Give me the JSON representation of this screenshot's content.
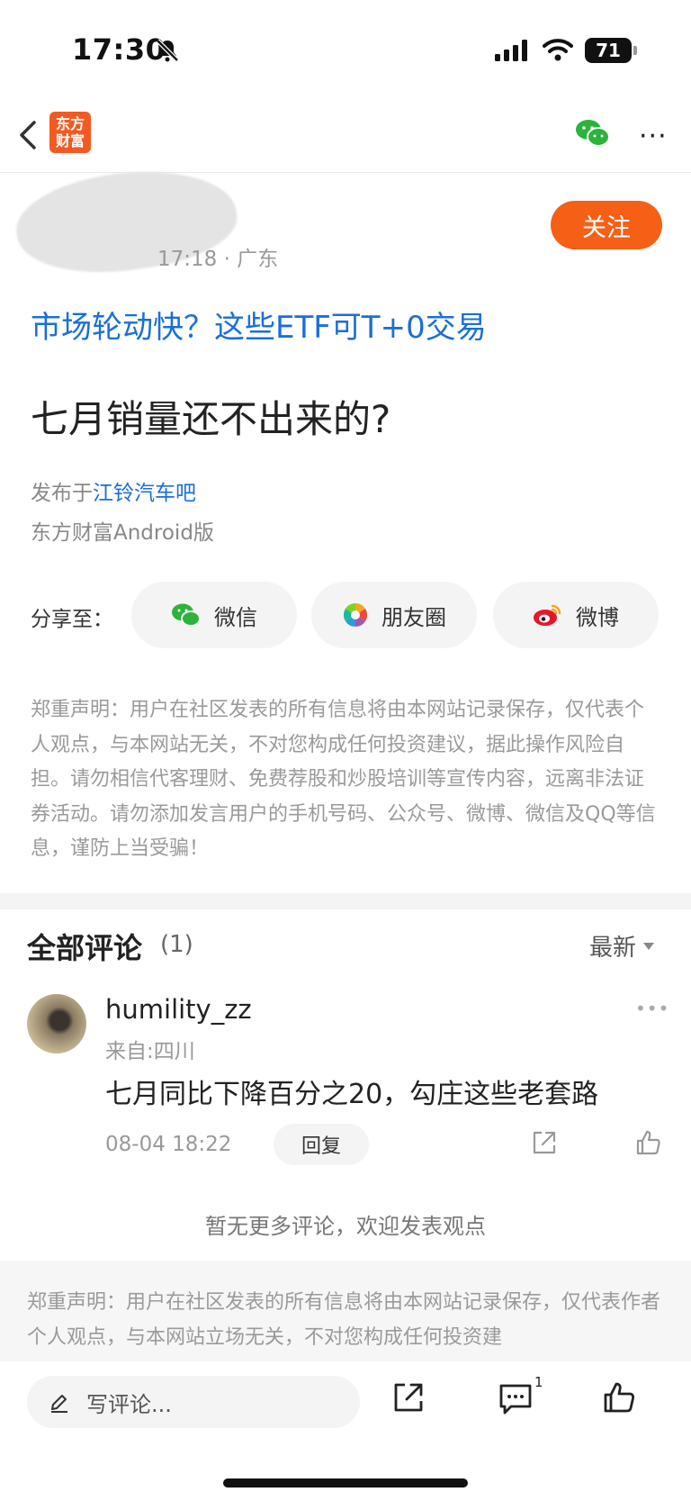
{
  "status": {
    "time": "17:30",
    "battery": "71"
  },
  "nav": {
    "logo_text": "东方财富"
  },
  "post": {
    "meta": "17:18 · 广东",
    "follow_label": "关注",
    "ad_link": "市场轮动快？这些ETF可T+0交易",
    "title": "七月销量还不出来的?",
    "published_prefix": "发布于",
    "bar_name": "江铃汽车吧",
    "platform": "东方财富Android版",
    "share_label": "分享至：",
    "share_options": [
      {
        "label": "微信",
        "icon": "wechat-icon"
      },
      {
        "label": "朋友圈",
        "icon": "moments-icon"
      },
      {
        "label": "微博",
        "icon": "weibo-icon"
      }
    ],
    "disclaimer": "郑重声明：用户在社区发表的所有信息将由本网站记录保存，仅代表个人观点，与本网站无关，不对您构成任何投资建议，据此操作风险自担。请勿相信代客理财、免费荐股和炒股培训等宣传内容，远离非法证券活动。请勿添加发言用户的手机号码、公众号、微博、微信及QQ等信息，谨防上当受骗！"
  },
  "comments": {
    "title": "全部评论",
    "count": "(1)",
    "sort_label": "最新",
    "items": [
      {
        "user": "humility_zz",
        "from": "来自:四川",
        "text": "七月同比下降百分之20，勾庄这些老套路",
        "time": "08-04 18:22",
        "reply_label": "回复"
      }
    ],
    "no_more": "暂无更多评论，欢迎发表观点"
  },
  "footer_disclaimer": "郑重声明：用户在社区发表的所有信息将由本网站记录保存，仅代表作者个人观点，与本网站立场无关，不对您构成任何投资建",
  "bottom_bar": {
    "input_placeholder": "写评论...",
    "comment_badge": "1"
  }
}
